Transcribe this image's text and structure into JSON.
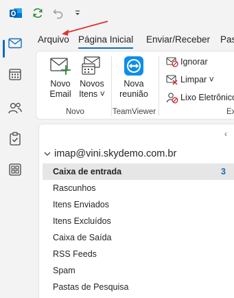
{
  "titlebar": {
    "icons": [
      "outlook-logo",
      "sync-icon",
      "undo-icon",
      "customize-quick-access-icon"
    ]
  },
  "rail": {
    "items": [
      {
        "name": "mail",
        "active": true
      },
      {
        "name": "calendar",
        "active": false
      },
      {
        "name": "people",
        "active": false
      },
      {
        "name": "tasks",
        "active": false
      },
      {
        "name": "apps",
        "active": false
      }
    ]
  },
  "ribbon_tabs": {
    "file": "Arquivo",
    "home": "Página Inicial",
    "send_receive": "Enviar/Receber",
    "more": "Pas"
  },
  "ribbon": {
    "new_email": [
      "Novo",
      "Email"
    ],
    "new_items": [
      "Novos",
      "Itens ˅"
    ],
    "new_group_label": "Novo",
    "new_meeting": [
      "Nova",
      "reunião"
    ],
    "teamviewer_group_label": "TeamViewer",
    "ignore": "Ignorar",
    "clean": "Limpar ˅",
    "junk": "Lixo Eletrônico",
    "delete_group_label": "Ex"
  },
  "folders": {
    "collapse_glyph": "‹",
    "account": "imap@vini.skydemo.com.br",
    "items": [
      {
        "label": "Caixa de entrada",
        "count": "3",
        "selected": true
      },
      {
        "label": "Rascunhos",
        "count": "",
        "selected": false
      },
      {
        "label": "Itens Enviados",
        "count": "",
        "selected": false
      },
      {
        "label": "Itens Excluídos",
        "count": "",
        "selected": false
      },
      {
        "label": "Caixa de Saída",
        "count": "",
        "selected": false
      },
      {
        "label": "RSS Feeds",
        "count": "",
        "selected": false
      },
      {
        "label": "Spam",
        "count": "",
        "selected": false
      },
      {
        "label": "Pastas de Pesquisa",
        "count": "",
        "selected": false
      }
    ]
  },
  "colors": {
    "accent": "#0f6cbd",
    "annotation_arrow": "#e03030"
  }
}
